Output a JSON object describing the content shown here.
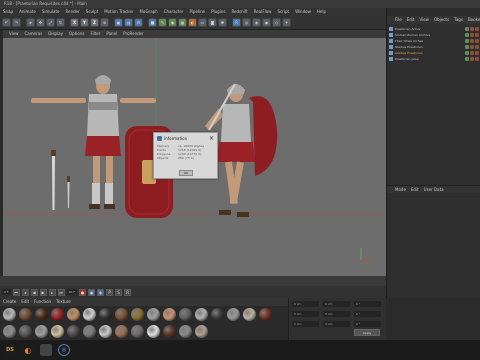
{
  "window": {
    "title": "R18 - [Praetorian Requisites.c4d *] - Main"
  },
  "menubar": [
    "Snap",
    "Animate",
    "Simulate",
    "Render",
    "Sculpt",
    "Motion Tracker",
    "MoGraph",
    "Character",
    "Pipeline",
    "Plugins",
    "Redshift",
    "RealFlow",
    "Script",
    "Window",
    "Help"
  ],
  "toolbar": {
    "axis_x": "X",
    "axis_y": "Y",
    "axis_z": "Z"
  },
  "viewport": {
    "menu": [
      "View",
      "Cameras",
      "Display",
      "Options",
      "Filter",
      "Panel",
      "ProRender"
    ]
  },
  "dialog": {
    "title": "Information",
    "rows": [
      {
        "label": "Memory",
        "value": "ca. 10000 kbytes"
      },
      {
        "label": "Points",
        "value": "1218 (12029 K)"
      },
      {
        "label": "Polygons",
        "value": "1200 (10770 K)"
      },
      {
        "label": "Objects",
        "value": "280 (73 K)"
      }
    ],
    "ok_label": "OK"
  },
  "object_manager": {
    "menu": [
      "File",
      "Edit",
      "View",
      "Objects",
      "Tags",
      "Bookmarks"
    ],
    "objects": [
      {
        "name": "Praetorian Armor",
        "selected": false
      },
      {
        "name": "Scutum Roman Archive",
        "selected": false
      },
      {
        "name": "Their times Arches",
        "selected": false
      },
      {
        "name": "Gladius Praetorian",
        "selected": false
      },
      {
        "name": "Gladius Praetorian",
        "selected": true
      },
      {
        "name": "Praetorian pose",
        "selected": false
      }
    ]
  },
  "attribute_manager": {
    "menu": [
      "Mode",
      "Edit",
      "User Data"
    ]
  },
  "transport": {
    "frame_start": "0 F",
    "frame_end": "90 F"
  },
  "material_manager": {
    "menu": [
      "Create",
      "Edit",
      "Function",
      "Texture"
    ],
    "swatches": [
      "#b8b8b8",
      "#6e4a30",
      "#4a2a1a",
      "#9a2020",
      "#c09060",
      "#d0d0d0",
      "#333333",
      "#7a5030",
      "#8a7030",
      "#a0a0a0",
      "#cc9070",
      "#606060",
      "#b0b0b0",
      "#3a3a3a",
      "#9a9a9a",
      "#c0b0a0",
      "#703020",
      "#8a8a8a",
      "#555555",
      "#a0a0a0",
      "#d0c0a0",
      "#4a4a4a",
      "#7a7a7a",
      "#c8c8c8",
      "#9a7050",
      "#6a6a6a",
      "#e0e0e0",
      "#5a3020",
      "#8a8a8a",
      "#b0a090"
    ]
  },
  "coordinates": {
    "rows": [
      [
        "0 cm",
        "0 cm",
        "0 °"
      ],
      [
        "0 cm",
        "0 cm",
        "0 °"
      ],
      [
        "0 cm",
        "0 cm",
        "0 °"
      ]
    ],
    "apply_label": "Apply"
  },
  "taskbar": {
    "items": [
      "DS",
      "B",
      "",
      "C4D"
    ]
  }
}
